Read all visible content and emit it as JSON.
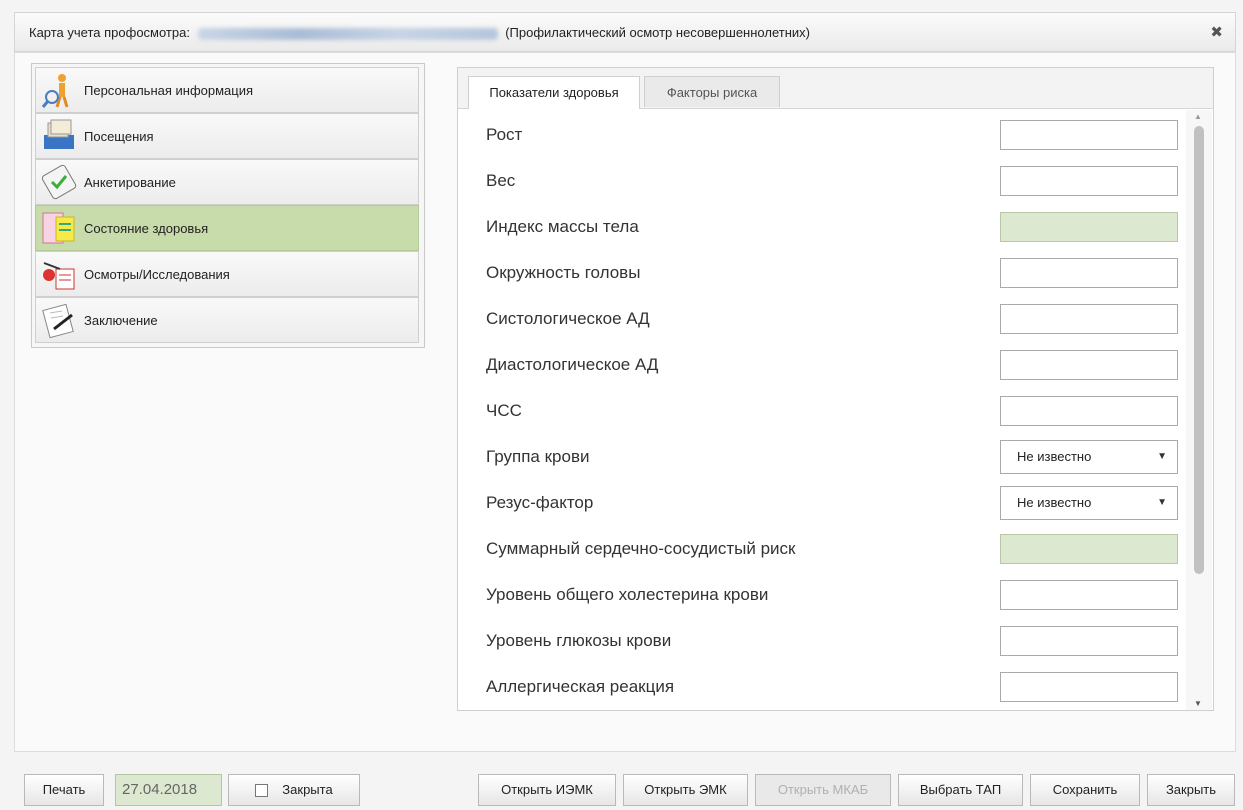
{
  "window": {
    "title_prefix": "Карта учета профосмотра:",
    "title_suffix": "(Профилактический осмотр несовершеннолетних)",
    "close_icon": "close-icon"
  },
  "nav": {
    "items": [
      {
        "label": "Персональная информация",
        "icon": "person-icon"
      },
      {
        "label": "Посещения",
        "icon": "folders-icon"
      },
      {
        "label": "Анкетирование",
        "icon": "clipboard-check-icon"
      },
      {
        "label": "Состояние здоровья",
        "icon": "notes-icon"
      },
      {
        "label": "Осмотры/Исследования",
        "icon": "exam-icon"
      },
      {
        "label": "Заключение",
        "icon": "pen-document-icon"
      }
    ],
    "active_index": 3
  },
  "tabs": [
    {
      "label": "Показатели здоровья",
      "active": true
    },
    {
      "label": "Факторы риска",
      "active": false
    }
  ],
  "fields": [
    {
      "label": "Рост",
      "type": "text",
      "value": ""
    },
    {
      "label": "Вес",
      "type": "text",
      "value": ""
    },
    {
      "label": "Индекс массы тела",
      "type": "readonly",
      "value": ""
    },
    {
      "label": "Окружность головы",
      "type": "text",
      "value": ""
    },
    {
      "label": "Систологическое АД",
      "type": "text",
      "value": ""
    },
    {
      "label": "Диастологическое АД",
      "type": "text",
      "value": ""
    },
    {
      "label": "ЧСС",
      "type": "text",
      "value": ""
    },
    {
      "label": "Группа крови",
      "type": "select",
      "value": "Не известно"
    },
    {
      "label": "Резус-фактор",
      "type": "select",
      "value": "Не известно"
    },
    {
      "label": "Суммарный сердечно-сосудистый риск",
      "type": "readonly",
      "value": ""
    },
    {
      "label": "Уровень общего холестерина крови",
      "type": "text",
      "value": ""
    },
    {
      "label": "Уровень глюкозы крови",
      "type": "text",
      "value": ""
    },
    {
      "label": "Аллергическая реакция",
      "type": "text",
      "value": ""
    }
  ],
  "footer": {
    "print": "Печать",
    "date": "27.04.2018",
    "closed_label": "Закрыта",
    "open_iemk": "Открыть ИЭМК",
    "open_emk": "Открыть ЭМК",
    "open_mkab": "Открыть МКАБ",
    "choose_tap": "Выбрать ТАП",
    "save": "Сохранить",
    "close": "Закрыть"
  },
  "colors": {
    "active_nav": "#c7dcaa",
    "readonly_field": "#dde8d0"
  }
}
